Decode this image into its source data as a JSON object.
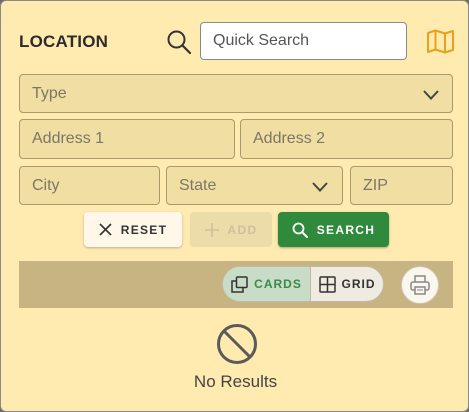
{
  "panel": {
    "title": "LOCATION"
  },
  "search": {
    "placeholder": "Quick Search"
  },
  "fields": {
    "type": "Type",
    "address1": "Address 1",
    "address2": "Address 2",
    "city": "City",
    "state": "State",
    "zip": "ZIP"
  },
  "actions": {
    "reset": "RESET",
    "add": "ADD",
    "search": "SEARCH"
  },
  "view": {
    "cards": "CARDS",
    "grid": "GRID",
    "selected": "CARDS"
  },
  "results": {
    "empty": "No Results"
  },
  "icons": [
    "search-icon",
    "map-icon",
    "chevron-down-icon",
    "close-icon",
    "plus-icon",
    "cards-icon",
    "grid-icon",
    "print-icon",
    "no-entry-icon"
  ],
  "colors": {
    "panel_bg": "#ffeab0",
    "field_bg": "#f1dea3",
    "accent_green": "#2f8a3c",
    "toolbar_bg": "#c7b482"
  }
}
